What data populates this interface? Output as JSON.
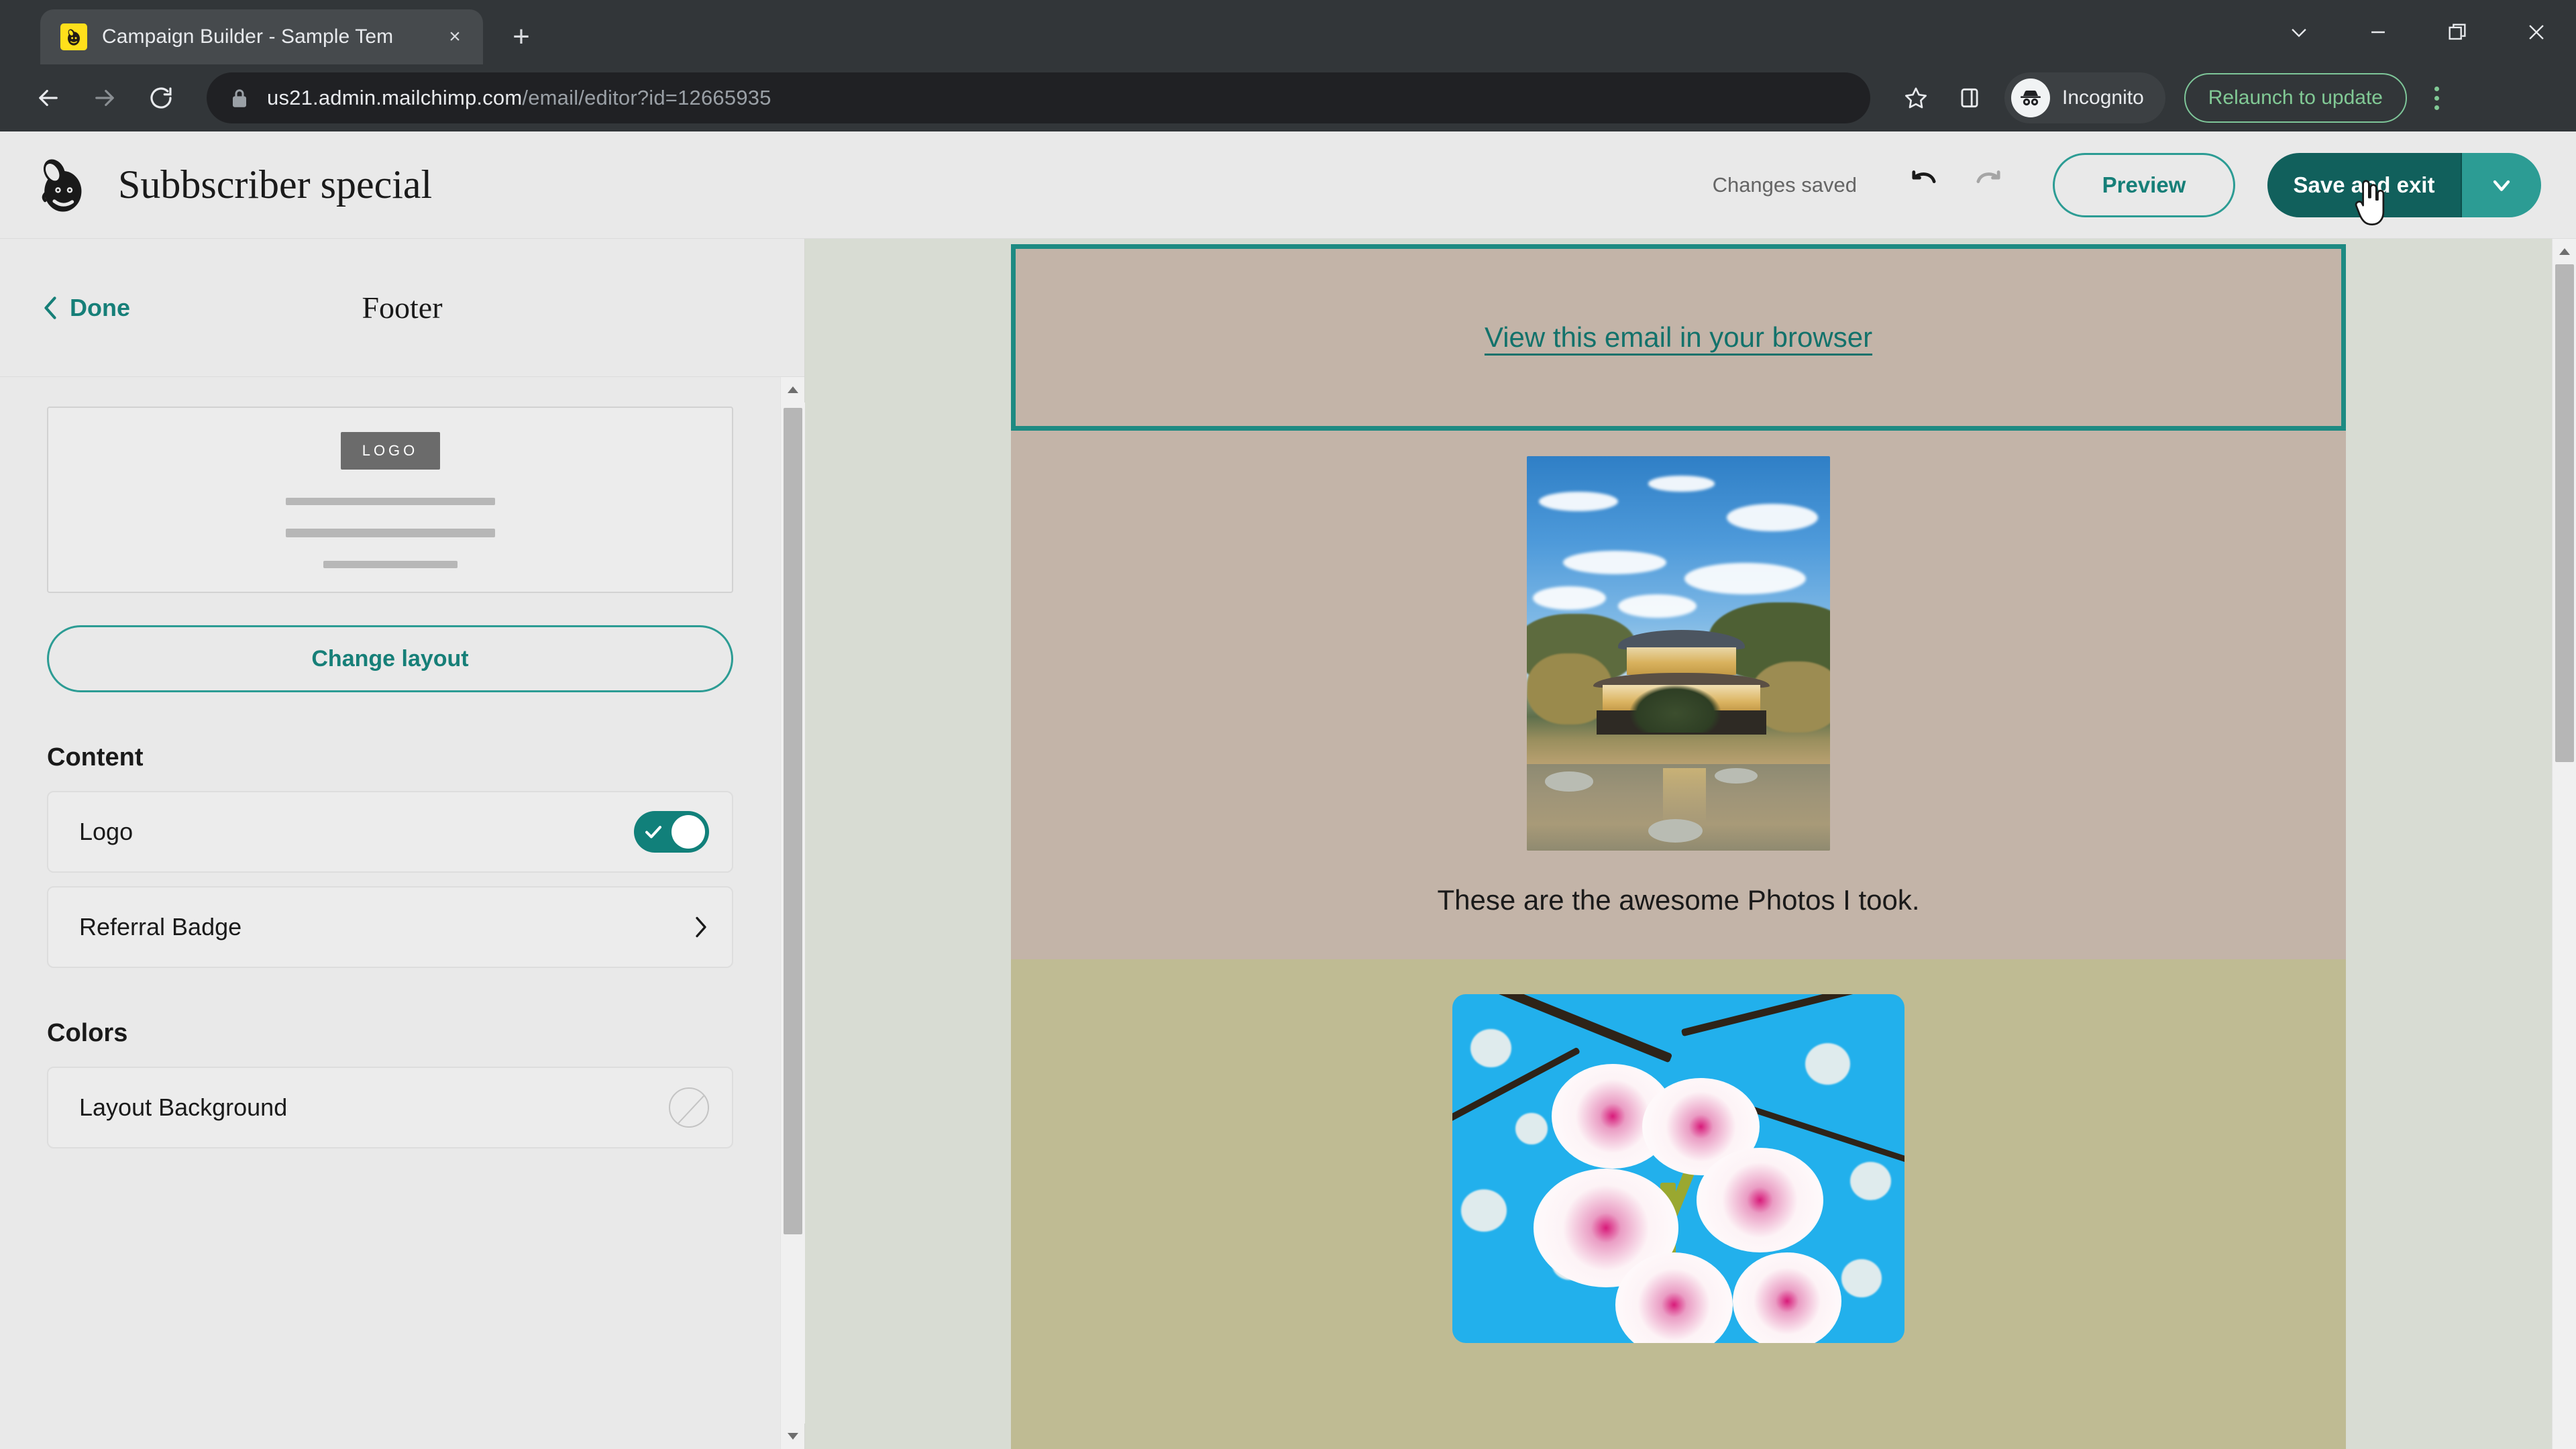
{
  "browser": {
    "tab": {
      "title": "Campaign Builder - Sample Tem",
      "favicon_name": "mailchimp-favicon",
      "close_label": "×"
    },
    "new_tab_label": "+",
    "window_controls": [
      {
        "name": "tab-search-button",
        "label": "tab-search-icon"
      },
      {
        "name": "minimize-button",
        "label": "minimize-icon"
      },
      {
        "name": "maximize-button",
        "label": "restore-icon"
      },
      {
        "name": "close-window-button",
        "label": "close-icon"
      }
    ],
    "nav": {
      "back_label": "back-icon",
      "forward_label": "forward-icon",
      "reload_label": "reload-icon"
    },
    "omnibox": {
      "lock_label": "lock-icon",
      "url_domain": "us21.admin.mailchimp.com",
      "url_path": "/email/editor?id=12665935",
      "full_url": "us21.admin.mailchimp.com/email/editor?id=12665935"
    },
    "bookmark_star_label": "star-icon",
    "side_panel_label": "side-panel-icon",
    "incognito_label": "Incognito",
    "relaunch_label": "Relaunch to update",
    "menu_label": "kebab-menu-icon"
  },
  "app": {
    "logo_name": "mailchimp-logo",
    "campaign_title": "Subbscriber special",
    "save_status": "Changes saved",
    "undo_label": "undo-icon",
    "redo_label": "redo-icon",
    "preview_label": "Preview",
    "save_label": "Save and exit",
    "save_caret_label": "chevron-down-icon"
  },
  "sidebar": {
    "done_label": "Done",
    "panel_title": "Footer",
    "layout_preview": {
      "logo_placeholder": "LOGO"
    },
    "change_layout_label": "Change layout",
    "sections": [
      {
        "title": "Content",
        "rows": [
          {
            "label": "Logo",
            "control": "toggle",
            "value": "on"
          },
          {
            "label": "Referral Badge",
            "control": "chevron",
            "value": ""
          }
        ]
      },
      {
        "title": "Colors",
        "rows": [
          {
            "label": "Layout Background",
            "control": "color-swatch",
            "value": "none"
          }
        ]
      }
    ]
  },
  "email_preview": {
    "view_in_browser_link": "View this email in your browser",
    "caption": "These are the awesome Photos I took.",
    "image_one_name": "golden-pavilion-photo",
    "image_two_name": "cherry-blossom-photo",
    "colors": {
      "beige_background": "#c3b4a8",
      "olive_background": "#bfbb93",
      "selection_border": "#1d8a82",
      "link_color": "#13726b",
      "canvas_background": "#d8dcd3"
    }
  },
  "theme": {
    "brand_teal": "#2c9c94",
    "brand_dark_teal": "#11605c",
    "link_teal": "#167f78",
    "chrome_dark": "#323639",
    "omnibox_dark": "#202124",
    "update_green": "#81c995"
  }
}
